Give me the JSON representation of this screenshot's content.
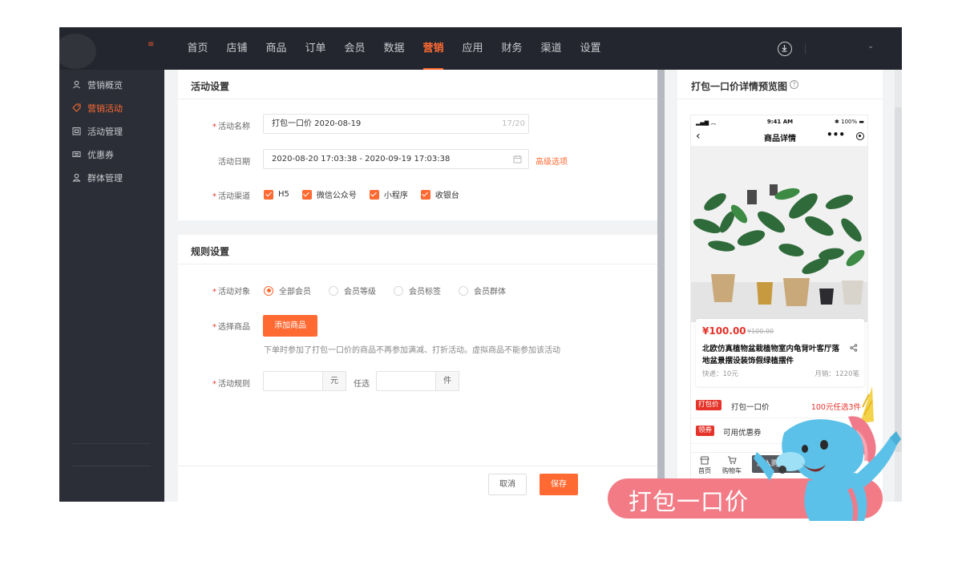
{
  "nav": {
    "items": [
      "首页",
      "店铺",
      "商品",
      "订单",
      "会员",
      "数据",
      "营销",
      "应用",
      "财务",
      "渠道",
      "设置"
    ],
    "active_index": 6
  },
  "sidebar": {
    "items": [
      {
        "label": "营销概览",
        "icon": "user-icon"
      },
      {
        "label": "营销活动",
        "icon": "tag-icon",
        "active": true
      },
      {
        "label": "活动管理",
        "icon": "calendar-icon"
      },
      {
        "label": "优惠券",
        "icon": "ticket-icon"
      },
      {
        "label": "群体管理",
        "icon": "group-icon"
      }
    ]
  },
  "activity": {
    "title": "活动设置",
    "name_label": "活动名称",
    "name_value": "打包一口价  2020-08-19",
    "name_count": "17/20",
    "date_label": "活动日期",
    "date_value": "2020-08-20 17:03:38 - 2020-09-19 17:03:38",
    "advanced_link": "高级选项",
    "channel_label": "活动渠道",
    "channels": [
      "H5",
      "微信公众号",
      "小程序",
      "收银台"
    ]
  },
  "rules": {
    "title": "规则设置",
    "target_label": "活动对象",
    "targets": [
      "全部会员",
      "会员等级",
      "会员标签",
      "会员群体"
    ],
    "target_selected": 0,
    "goods_label": "选择商品",
    "add_goods_button": "添加商品",
    "goods_hint": "下单时参加了打包一口价的商品不再参加满减、打折活动。虚拟商品不能参加该活动",
    "rule_label": "活动规则",
    "unit_yuan": "元",
    "pick_text": "任选",
    "unit_jian": "件"
  },
  "footer": {
    "cancel": "取消",
    "save": "保存"
  },
  "preview": {
    "title": "打包一口价详情预览图",
    "help": "?",
    "status_time": "9:41 AM",
    "battery": "100%",
    "page_title": "商品详情",
    "price": "¥100.00",
    "price_old": "¥100.00",
    "product_name": "北欧仿真植物盆栽植物室内龟背叶客厅落地盆景摆设装饰假绿植摆件",
    "shipping": "快递：10元",
    "sold": "月销：1220笔",
    "promo_tag": "打包价",
    "promo_text": "打包一口价",
    "promo_detail": "100元任选3件",
    "coupon_tag": "领券",
    "coupon_text": "可用优惠券",
    "tab_home": "首页",
    "tab_cart": "购物车",
    "buy_button": "加入购物"
  },
  "banner": {
    "text": "打包一口价"
  },
  "colors": {
    "accent": "#ff6a33",
    "topbar": "#23262e",
    "sidebar": "#2b2e36",
    "banner": "#f37b86",
    "price_red": "#e5332a"
  }
}
